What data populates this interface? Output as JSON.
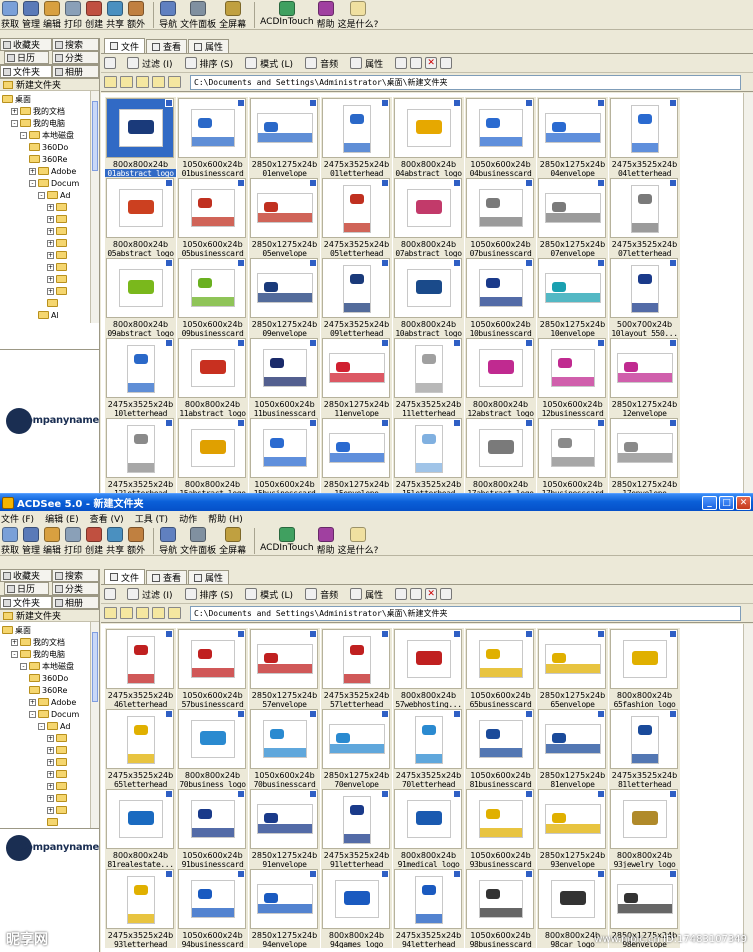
{
  "window1": {
    "toolbar": [
      "获取",
      "管理",
      "编辑",
      "打印",
      "创建",
      "共享",
      "额外",
      "导航",
      "文件面板",
      "全屏幕",
      "ACDInTouch",
      "帮助",
      "这是什么?"
    ],
    "left_tabs": [
      "收藏夹",
      "搜索",
      "日历",
      "分类",
      "文件夹",
      "相册"
    ],
    "folder_title": "新建文件夹",
    "tree": [
      {
        "label": "桌面",
        "level": 0,
        "expander": ""
      },
      {
        "label": "我的文档",
        "level": 1,
        "expander": "+"
      },
      {
        "label": "我的电脑",
        "level": 1,
        "expander": "-"
      },
      {
        "label": "本地磁盘",
        "level": 2,
        "expander": "-"
      },
      {
        "label": "360Do",
        "level": 3,
        "expander": ""
      },
      {
        "label": "360Re",
        "level": 3,
        "expander": ""
      },
      {
        "label": "Adobe",
        "level": 3,
        "expander": "+"
      },
      {
        "label": "Docum",
        "level": 3,
        "expander": "-"
      },
      {
        "label": "Ad",
        "level": 4,
        "expander": "-"
      },
      {
        "label": "",
        "level": 5,
        "expander": "+"
      },
      {
        "label": "",
        "level": 5,
        "expander": "+"
      },
      {
        "label": "",
        "level": 5,
        "expander": "+"
      },
      {
        "label": "",
        "level": 5,
        "expander": "+"
      },
      {
        "label": "",
        "level": 5,
        "expander": "+"
      },
      {
        "label": "",
        "level": 5,
        "expander": "+"
      },
      {
        "label": "",
        "level": 5,
        "expander": "+"
      },
      {
        "label": "",
        "level": 5,
        "expander": "+"
      },
      {
        "label": "",
        "level": 5,
        "expander": ""
      },
      {
        "label": "Al",
        "level": 4,
        "expander": ""
      }
    ],
    "preview_logo": "Companyname",
    "tabs": [
      "文件",
      "查看",
      "属性"
    ],
    "subtoolbar": {
      "filter": "过滤 (I)",
      "sort": "排序 (S)",
      "mode": "模式 (L)",
      "audio": "音频",
      "props": "属性"
    },
    "path": "C:\\Documents and Settings\\Administrator\\桌面\\新建文件夹",
    "files": [
      {
        "dim": "800x800x24b",
        "name": "01abstract_logo",
        "kind": "logo",
        "accent": "#1a3a7a",
        "selected": true
      },
      {
        "dim": "1050x600x24b",
        "name": "01businesscard",
        "kind": "card",
        "accent": "#2a68c8"
      },
      {
        "dim": "2850x1275x24b",
        "name": "01envelope",
        "kind": "env",
        "accent": "#2a68c8"
      },
      {
        "dim": "2475x3525x24b",
        "name": "01letterhead",
        "kind": "letter",
        "accent": "#2a68c8"
      },
      {
        "dim": "800x800x24b",
        "name": "04abstract_logo",
        "kind": "logo",
        "accent": "#e6a800"
      },
      {
        "dim": "1050x600x24b",
        "name": "04businesscard",
        "kind": "card",
        "accent": "#2a6ad0"
      },
      {
        "dim": "2850x1275x24b",
        "name": "04envelope",
        "kind": "env",
        "accent": "#2a6ad0"
      },
      {
        "dim": "2475x3525x24b",
        "name": "04letterhead",
        "kind": "letter",
        "accent": "#2a6ad0"
      },
      {
        "dim": "800x800x24b",
        "name": "05abstract_logo",
        "kind": "logo",
        "accent": "#cc4020"
      },
      {
        "dim": "1050x600x24b",
        "name": "05businesscard",
        "kind": "card",
        "accent": "#c03020"
      },
      {
        "dim": "2850x1275x24b",
        "name": "05envelope",
        "kind": "env",
        "accent": "#c03020"
      },
      {
        "dim": "2475x3525x24b",
        "name": "05letterhead",
        "kind": "letter",
        "accent": "#c03020"
      },
      {
        "dim": "800x800x24b",
        "name": "07abstract_logo",
        "kind": "logo",
        "accent": "#c23a6a"
      },
      {
        "dim": "1050x600x24b",
        "name": "07businesscard",
        "kind": "card",
        "accent": "#7a7a7a"
      },
      {
        "dim": "2850x1275x24b",
        "name": "07envelope",
        "kind": "env",
        "accent": "#7a7a7a"
      },
      {
        "dim": "2475x3525x24b",
        "name": "07letterhead",
        "kind": "letter",
        "accent": "#7a7a7a"
      },
      {
        "dim": "800x800x24b",
        "name": "09abstract_logo",
        "kind": "logo",
        "accent": "#7ab81c"
      },
      {
        "dim": "1050x600x24b",
        "name": "09businesscard",
        "kind": "card",
        "accent": "#6ab020"
      },
      {
        "dim": "2850x1275x24b",
        "name": "09envelope",
        "kind": "env",
        "accent": "#1a3a7a"
      },
      {
        "dim": "2475x3525x24b",
        "name": "09letterhead",
        "kind": "letter",
        "accent": "#1a3a7a"
      },
      {
        "dim": "800x800x24b",
        "name": "10abstract_logo",
        "kind": "logo",
        "accent": "#1a4a8a"
      },
      {
        "dim": "1050x600x24b",
        "name": "10businesscard",
        "kind": "card",
        "accent": "#1a3a8a"
      },
      {
        "dim": "2850x1275x24b",
        "name": "10envelope",
        "kind": "env",
        "accent": "#1aa0b0"
      },
      {
        "dim": "500x700x24b",
        "name": "10layout_550...",
        "kind": "letter",
        "accent": "#1a3a8a"
      },
      {
        "dim": "2475x3525x24b",
        "name": "10letterhead",
        "kind": "letter",
        "accent": "#2a68c8"
      },
      {
        "dim": "800x800x24b",
        "name": "11abstract_logo",
        "kind": "logo",
        "accent": "#c83020"
      },
      {
        "dim": "1050x600x24b",
        "name": "11businesscard",
        "kind": "card",
        "accent": "#1a2a6a"
      },
      {
        "dim": "2850x1275x24b",
        "name": "11envelope",
        "kind": "env",
        "accent": "#d02030"
      },
      {
        "dim": "2475x3525x24b",
        "name": "11letterhead",
        "kind": "letter",
        "accent": "#a0a0a0"
      },
      {
        "dim": "800x800x24b",
        "name": "12abstract_logo",
        "kind": "logo",
        "accent": "#c02a90"
      },
      {
        "dim": "1050x600x24b",
        "name": "12businesscard",
        "kind": "card",
        "accent": "#c02a90"
      },
      {
        "dim": "2850x1275x24b",
        "name": "12envelope",
        "kind": "env",
        "accent": "#c02a90"
      },
      {
        "dim": "2475x3525x24b",
        "name": "12letterhead",
        "kind": "letter",
        "accent": "#8a8a8a"
      },
      {
        "dim": "800x800x24b",
        "name": "15abstract_logo",
        "kind": "logo",
        "accent": "#e0a000"
      },
      {
        "dim": "1050x600x24b",
        "name": "15businesscard",
        "kind": "card",
        "accent": "#2a6ad0"
      },
      {
        "dim": "2850x1275x24b",
        "name": "15envelope",
        "kind": "env",
        "accent": "#2a6ad0"
      },
      {
        "dim": "2475x3525x24b",
        "name": "15letterhead",
        "kind": "letter",
        "accent": "#80b0e0"
      },
      {
        "dim": "800x800x24b",
        "name": "17abstract_logo",
        "kind": "logo",
        "accent": "#7a7a7a"
      },
      {
        "dim": "1050x600x24b",
        "name": "17businesscard",
        "kind": "card",
        "accent": "#8a8a8a"
      },
      {
        "dim": "2850x1275x24b",
        "name": "17envelope",
        "kind": "env",
        "accent": "#8a8a8a"
      }
    ]
  },
  "window2": {
    "title": "ACDSee 5.0 - 新建文件夹",
    "menu": [
      "文件 (F)",
      "编辑 (E)",
      "查看 (V)",
      "工具 (T)",
      "动作",
      "帮助 (H)"
    ],
    "toolbar": [
      "获取",
      "管理",
      "编辑",
      "打印",
      "创建",
      "共享",
      "额外",
      "导航",
      "文件面板",
      "全屏幕",
      "ACDInTouch",
      "帮助",
      "这是什么?"
    ],
    "left_tabs": [
      "收藏夹",
      "搜索",
      "日历",
      "分类",
      "文件夹",
      "相册"
    ],
    "folder_title": "新建文件夹",
    "tree": [
      {
        "label": "桌面",
        "level": 0,
        "expander": ""
      },
      {
        "label": "我的文档",
        "level": 1,
        "expander": "+"
      },
      {
        "label": "我的电脑",
        "level": 1,
        "expander": "-"
      },
      {
        "label": "本地磁盘",
        "level": 2,
        "expander": "-"
      },
      {
        "label": "360Do",
        "level": 3,
        "expander": ""
      },
      {
        "label": "360Re",
        "level": 3,
        "expander": ""
      },
      {
        "label": "Adobe",
        "level": 3,
        "expander": "+"
      },
      {
        "label": "Docum",
        "level": 3,
        "expander": "-"
      },
      {
        "label": "Ad",
        "level": 4,
        "expander": "-"
      },
      {
        "label": "",
        "level": 5,
        "expander": "+"
      },
      {
        "label": "",
        "level": 5,
        "expander": "+"
      },
      {
        "label": "",
        "level": 5,
        "expander": "+"
      },
      {
        "label": "",
        "level": 5,
        "expander": "+"
      },
      {
        "label": "",
        "level": 5,
        "expander": "+"
      },
      {
        "label": "",
        "level": 5,
        "expander": "+"
      },
      {
        "label": "",
        "level": 5,
        "expander": "+"
      },
      {
        "label": "",
        "level": 5,
        "expander": ""
      }
    ],
    "preview_logo": "Companyname",
    "tabs": [
      "文件",
      "查看",
      "属性"
    ],
    "subtoolbar": {
      "filter": "过滤 (I)",
      "sort": "排序 (S)",
      "mode": "模式 (L)",
      "audio": "音频",
      "props": "属性"
    },
    "path": "C:\\Documents and Settings\\Administrator\\桌面\\新建文件夹",
    "files": [
      {
        "dim": "2475x3525x24b",
        "name": "46letterhead",
        "kind": "letter",
        "accent": "#c02020"
      },
      {
        "dim": "1050x600x24b",
        "name": "57businesscard",
        "kind": "card",
        "accent": "#c02020"
      },
      {
        "dim": "2850x1275x24b",
        "name": "57envelope",
        "kind": "env",
        "accent": "#c02020"
      },
      {
        "dim": "2475x3525x24b",
        "name": "57letterhead",
        "kind": "letter",
        "accent": "#c02020"
      },
      {
        "dim": "800x800x24b",
        "name": "57webhosting...",
        "kind": "logo",
        "accent": "#c02020"
      },
      {
        "dim": "1050x600x24b",
        "name": "65businesscard",
        "kind": "card",
        "accent": "#e0b000"
      },
      {
        "dim": "2850x1275x24b",
        "name": "65envelope",
        "kind": "env",
        "accent": "#e0b000"
      },
      {
        "dim": "800x800x24b",
        "name": "65fashion_logo",
        "kind": "logo",
        "accent": "#e0b000"
      },
      {
        "dim": "2475x3525x24b",
        "name": "65letterhead",
        "kind": "letter",
        "accent": "#e0b000"
      },
      {
        "dim": "800x800x24b",
        "name": "70business_logo",
        "kind": "logo",
        "accent": "#2a8ad0"
      },
      {
        "dim": "1050x600x24b",
        "name": "70businesscard",
        "kind": "card",
        "accent": "#2a8ad0"
      },
      {
        "dim": "2850x1275x24b",
        "name": "70envelope",
        "kind": "env",
        "accent": "#2a8ad0"
      },
      {
        "dim": "2475x3525x24b",
        "name": "70letterhead",
        "kind": "letter",
        "accent": "#2a8ad0"
      },
      {
        "dim": "1050x600x24b",
        "name": "81businesscard",
        "kind": "card",
        "accent": "#1a4a9a"
      },
      {
        "dim": "2850x1275x24b",
        "name": "81envelope",
        "kind": "env",
        "accent": "#1a4a9a"
      },
      {
        "dim": "2475x3525x24b",
        "name": "81letterhead",
        "kind": "letter",
        "accent": "#1a4a9a"
      },
      {
        "dim": "800x800x24b",
        "name": "81realestate...",
        "kind": "logo",
        "accent": "#1a6ac0"
      },
      {
        "dim": "1050x600x24b",
        "name": "91businesscard",
        "kind": "card",
        "accent": "#1a3a8a"
      },
      {
        "dim": "2850x1275x24b",
        "name": "91envelope",
        "kind": "env",
        "accent": "#1a3a8a"
      },
      {
        "dim": "2475x3525x24b",
        "name": "91letterhead",
        "kind": "letter",
        "accent": "#1a3a8a"
      },
      {
        "dim": "800x800x24b",
        "name": "91medical_logo",
        "kind": "logo",
        "accent": "#1a5ab0"
      },
      {
        "dim": "1050x600x24b",
        "name": "93businesscard",
        "kind": "card",
        "accent": "#e0b000"
      },
      {
        "dim": "2850x1275x24b",
        "name": "93envelope",
        "kind": "env",
        "accent": "#e0b000"
      },
      {
        "dim": "800x800x24b",
        "name": "93jewelry_logo",
        "kind": "logo",
        "accent": "#b08a2a"
      },
      {
        "dim": "2475x3525x24b",
        "name": "93letterhead",
        "kind": "letter",
        "accent": "#e0b000"
      },
      {
        "dim": "1050x600x24b",
        "name": "94businesscard",
        "kind": "card",
        "accent": "#1a5ac0"
      },
      {
        "dim": "2850x1275x24b",
        "name": "94envelope",
        "kind": "env",
        "accent": "#1a5ac0"
      },
      {
        "dim": "800x800x24b",
        "name": "94games_logo",
        "kind": "logo",
        "accent": "#1a5ac0"
      },
      {
        "dim": "2475x3525x24b",
        "name": "94letterhead",
        "kind": "letter",
        "accent": "#1a5ac0"
      },
      {
        "dim": "1050x600x24b",
        "name": "98businesscard",
        "kind": "card",
        "accent": "#333333"
      },
      {
        "dim": "800x800x24b",
        "name": "98car_logo",
        "kind": "logo",
        "accent": "#333333"
      },
      {
        "dim": "2850x1275x24b",
        "name": "98envelope",
        "kind": "env",
        "accent": "#333333"
      }
    ]
  },
  "watermark": {
    "left": "昵享网",
    "right": "www.nipic.cn  ID:17483107349"
  }
}
